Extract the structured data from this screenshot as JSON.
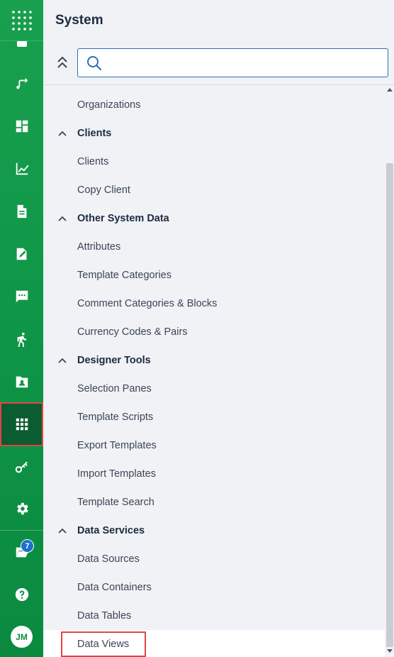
{
  "panel": {
    "title": "System",
    "search_placeholder": ""
  },
  "rail": {
    "items": [
      {
        "icon": "apps-grid-icon"
      },
      {
        "icon": "workflow-icon"
      },
      {
        "icon": "dashboard-icon"
      },
      {
        "icon": "chart-icon"
      },
      {
        "icon": "document-icon"
      },
      {
        "icon": "edit-document-icon"
      },
      {
        "icon": "comments-icon"
      },
      {
        "icon": "run-icon"
      },
      {
        "icon": "contacts-folder-icon"
      },
      {
        "icon": "system-grid-icon"
      },
      {
        "icon": "key-icon"
      },
      {
        "icon": "settings-icon"
      },
      {
        "icon": "folder-open-icon"
      },
      {
        "icon": "help-icon"
      }
    ],
    "notification_count": "7",
    "avatar_initials": "JM"
  },
  "menu": {
    "organizations": "Organizations",
    "clients_group": "Clients",
    "clients": "Clients",
    "copy_client": "Copy Client",
    "other_group": "Other System Data",
    "attributes": "Attributes",
    "template_categories": "Template Categories",
    "comment_categories": "Comment Categories & Blocks",
    "currency_codes": "Currency Codes & Pairs",
    "designer_group": "Designer Tools",
    "selection_panes": "Selection Panes",
    "template_scripts": "Template Scripts",
    "export_templates": "Export Templates",
    "import_templates": "Import Templates",
    "template_search": "Template Search",
    "data_services_group": "Data Services",
    "data_sources": "Data Sources",
    "data_containers": "Data Containers",
    "data_tables": "Data Tables",
    "data_views": "Data Views"
  },
  "colors": {
    "rail_green": "#0e9446",
    "active_rail": "#0b5c30",
    "highlight_red": "#e04545",
    "search_border": "#2f6fb3",
    "badge_blue": "#1f6fd1"
  }
}
